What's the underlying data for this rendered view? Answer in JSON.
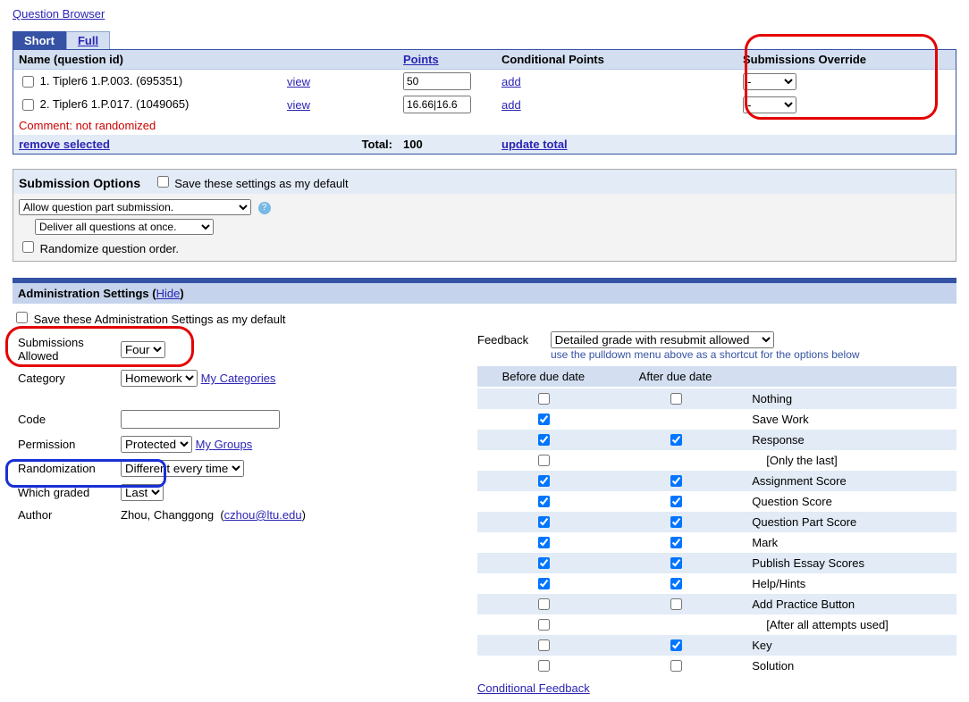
{
  "links": {
    "question_browser": "Question Browser"
  },
  "tabs": {
    "short": "Short",
    "full": "Full"
  },
  "qtable": {
    "headers": {
      "name": "Name (question id)",
      "points": "Points",
      "cond_points": "Conditional Points",
      "sub_override": "Submissions Override"
    },
    "rows": [
      {
        "idx": "1.",
        "name": "Tipler6 1.P.003.",
        "id": "(695351)",
        "view": "view",
        "points": "50",
        "add": "add",
        "override": "-"
      },
      {
        "idx": "2.",
        "name": "Tipler6 1.P.017.",
        "id": "(1049065)",
        "view": "view",
        "points": "16.66|16.6",
        "add": "add",
        "override": "-"
      }
    ],
    "comment": "Comment: not randomized",
    "remove": "remove selected",
    "total_label": "Total:",
    "total_value": "100",
    "update_total": "update total"
  },
  "sub_options": {
    "title": "Submission Options",
    "save_default": "Save these settings as my default",
    "part_submission": "Allow question part submission.",
    "deliver": "Deliver all questions at once.",
    "randomize": "Randomize question order."
  },
  "admin": {
    "title": "Administration Settings",
    "hide": "Hide",
    "save_default": "Save these Administration Settings as my default",
    "labels": {
      "submissions_allowed": "Submissions Allowed",
      "category": "Category",
      "code": "Code",
      "permission": "Permission",
      "randomization": "Randomization",
      "which_graded": "Which graded",
      "author": "Author"
    },
    "values": {
      "submissions_allowed": "Four",
      "category": "Homework",
      "my_categories": "My Categories",
      "code": "",
      "permission": "Protected",
      "my_groups": "My Groups",
      "randomization": "Different every time",
      "which_graded": "Last",
      "author_name": "Zhou, Changgong",
      "author_email": "czhou@ltu.edu"
    }
  },
  "feedback": {
    "label": "Feedback",
    "select": "Detailed grade with resubmit allowed",
    "hint": "use the pulldown menu above as a shortcut for the options below",
    "col_before": "Before due date",
    "col_after": "After due date",
    "rows": [
      {
        "label": "Nothing",
        "before": false,
        "after": false,
        "alt": true
      },
      {
        "label": "Save Work",
        "before": true,
        "after": null,
        "alt": false
      },
      {
        "label": "Response",
        "before": true,
        "after": true,
        "alt": true
      },
      {
        "label": "[Only the last]",
        "before": false,
        "after": null,
        "alt": false,
        "indent": true
      },
      {
        "label": "Assignment Score",
        "before": true,
        "after": true,
        "alt": true
      },
      {
        "label": "Question Score",
        "before": true,
        "after": true,
        "alt": false
      },
      {
        "label": "Question Part Score",
        "before": true,
        "after": true,
        "alt": true
      },
      {
        "label": "Mark",
        "before": true,
        "after": true,
        "alt": false
      },
      {
        "label": "Publish Essay Scores",
        "before": true,
        "after": true,
        "alt": true
      },
      {
        "label": "Help/Hints",
        "before": true,
        "after": true,
        "alt": false
      },
      {
        "label": "Add Practice Button",
        "before": false,
        "after": false,
        "alt": true
      },
      {
        "label": "[After all attempts used]",
        "before": false,
        "after": null,
        "alt": false,
        "indent": true
      },
      {
        "label": "Key",
        "before": false,
        "after": true,
        "alt": true
      },
      {
        "label": "Solution",
        "before": false,
        "after": false,
        "alt": false
      }
    ],
    "conditional_feedback": "Conditional Feedback"
  }
}
